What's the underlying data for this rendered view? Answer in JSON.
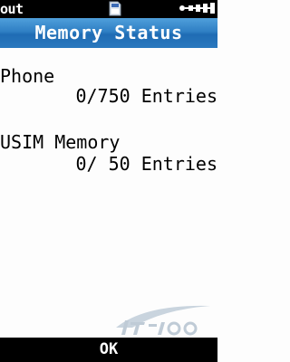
{
  "status_bar": {
    "left_text": "out",
    "sd_icon": "memory-card-icon",
    "signal_icon": "signal-icon"
  },
  "header": {
    "title": "Memory Status"
  },
  "entries": [
    {
      "label": "Phone",
      "value": "0/750 Entries"
    },
    {
      "label": "USIM Memory",
      "value": "0/ 50 Entries"
    }
  ],
  "softkeys": {
    "center": "OK"
  },
  "colors": {
    "title_bar": "#2f7fc4",
    "bars": "#000000",
    "background": "#fdfdfd"
  }
}
